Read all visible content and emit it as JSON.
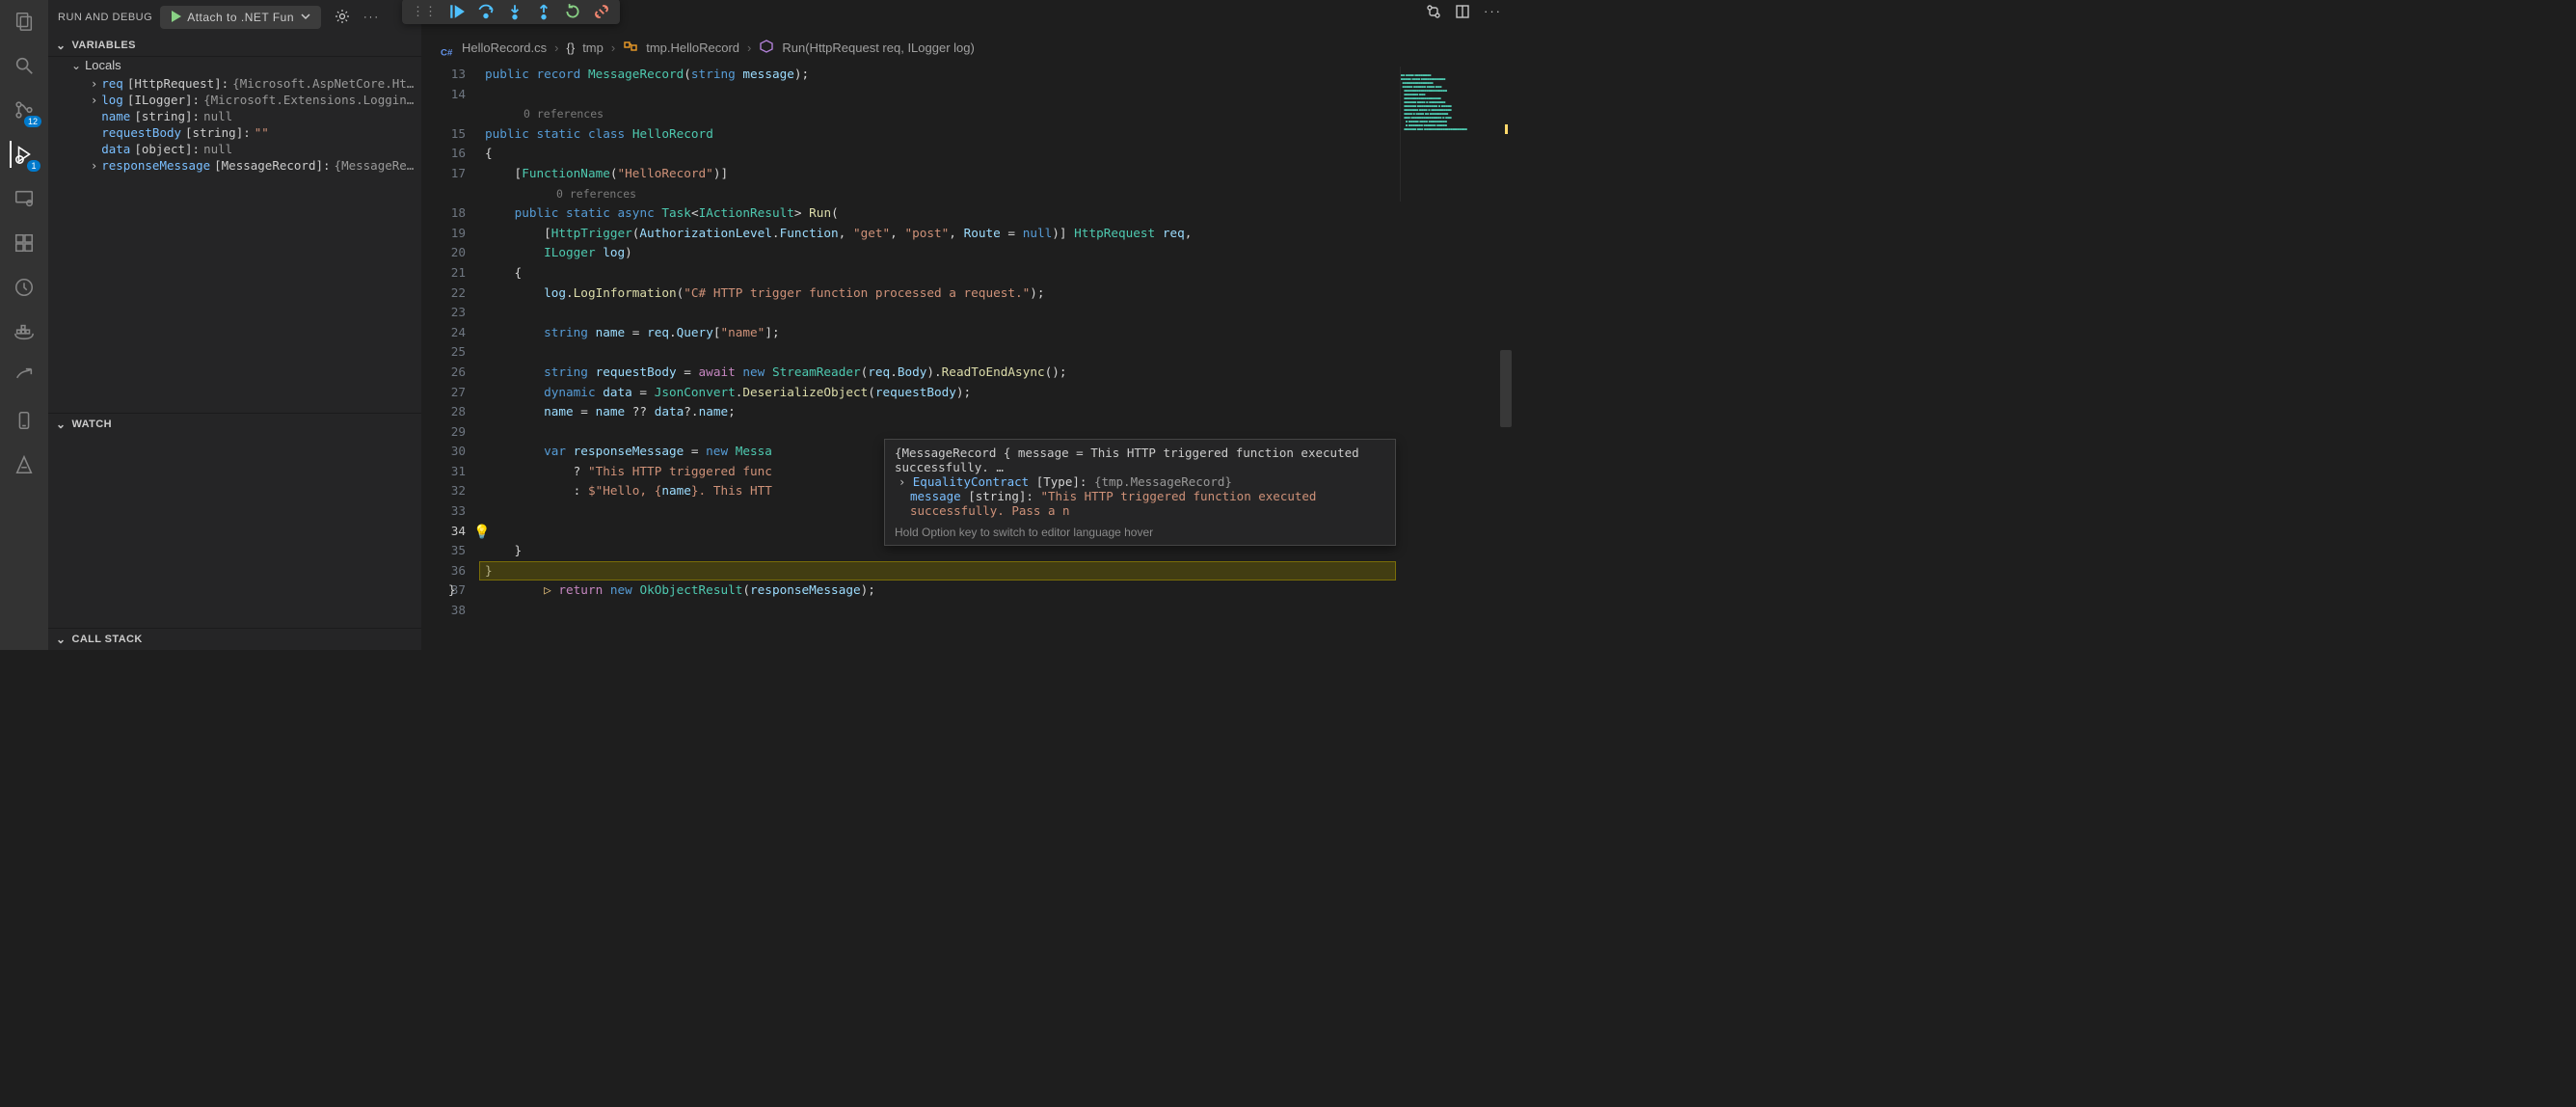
{
  "activity": {
    "scm_badge": "12",
    "debug_badge": "1"
  },
  "sidebar": {
    "title": "RUN AND DEBUG",
    "config_label": "Attach to .NET Fun",
    "sections": {
      "variables": "VARIABLES",
      "locals": "Locals",
      "watch": "WATCH",
      "callstack": "CALL STACK"
    },
    "vars": [
      {
        "expand": true,
        "name": "req",
        "type": "[HttpRequest]:",
        "val": "{Microsoft.AspNetCore.Ht…"
      },
      {
        "expand": true,
        "name": "log",
        "type": "[ILogger]:",
        "val": "{Microsoft.Extensions.Loggin…"
      },
      {
        "expand": false,
        "name": "name",
        "type": "[string]:",
        "val": "null",
        "valClass": "null"
      },
      {
        "expand": false,
        "name": "requestBody",
        "type": "[string]:",
        "val": "\"\"",
        "valClass": "str"
      },
      {
        "expand": false,
        "name": "data",
        "type": "[object]:",
        "val": "null",
        "valClass": "null"
      },
      {
        "expand": true,
        "name": "responseMessage",
        "type": "[MessageRecord]:",
        "val": "{MessageRe…"
      }
    ]
  },
  "breadcrumb": {
    "file": "HelloRecord.cs",
    "ns": "tmp",
    "class": "tmp.HelloRecord",
    "method": "Run(HttpRequest req, ILogger log)"
  },
  "codelens": {
    "zero": "0 references"
  },
  "lines": {
    "start": 13,
    "end": 38
  },
  "code": {
    "l13": {
      "pre": "    ",
      "kw": "public",
      "mid": " ",
      "kw2": "record",
      "rest1": " ",
      "type": "MessageRecord",
      "rest2": "(",
      "kw3": "string",
      "rest3": " ",
      "id": "message",
      "rest4": ");"
    },
    "l15": "    public static class HelloRecord",
    "l16": "    {",
    "l17_open": "        [",
    "l17_fn": "FunctionName",
    "l17_arg": "(\"HelloRecord\")",
    "l17_close": "]",
    "l18": "        public static async Task<IActionResult> Run(",
    "l19": "            [HttpTrigger(AuthorizationLevel.Function, \"get\", \"post\", Route = null)] HttpRequest req,",
    "l20": "            ILogger log)",
    "l21": "        {",
    "l22": "            log.LogInformation(\"C# HTTP trigger function processed a request.\");",
    "l24": "            string name = req.Query[\"name\"];",
    "l26": "            string requestBody = await new StreamReader(req.Body).ReadToEndAsync();",
    "l27": "            dynamic data = JsonConvert.DeserializeObject(requestBody);",
    "l28": "            name = name ?? data?.name;",
    "l30": "            var responseMessage = new Messa",
    "l31": "                ? \"This HTTP triggered func",
    "l32": "                : $\"Hello, {name}. This HTT",
    "l34": "            return new OkObjectResult(responseMessage);",
    "l35": "        }",
    "l36": "    }",
    "l37": "}"
  },
  "hover": {
    "line1": "{MessageRecord { message = This HTTP triggered function executed successfully. …",
    "line2_name": "EqualityContract",
    "line2_type": "[Type]:",
    "line2_val": "{tmp.MessageRecord}",
    "line3_name": "message",
    "line3_type": "[string]:",
    "line3_val": "\"This HTTP triggered function executed successfully. Pass a n",
    "hint": "Hold Option key to switch to editor language hover"
  }
}
